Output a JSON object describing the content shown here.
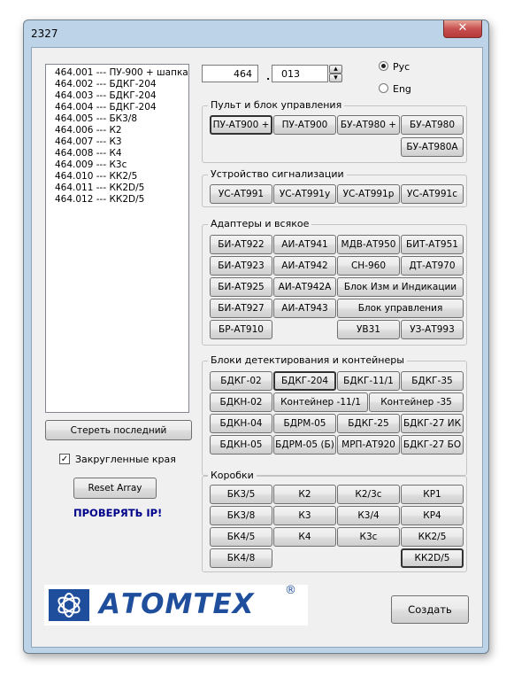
{
  "window": {
    "title": "2327",
    "close_glyph": "✕"
  },
  "list": {
    "items": [
      "464.001 --- ПУ-900 + шапка",
      "464.002 --- БДКГ-204",
      "464.003 --- БДКГ-204",
      "464.004 --- БДКГ-204",
      "464.005 --- БК3/8",
      "464.006 --- К2",
      "464.007 --- К3",
      "464.008 --- К4",
      "464.009 --- К3с",
      "464.010 --- КК2/5",
      "464.011 --- КК2D/5",
      "464.012 --- КК2D/5"
    ]
  },
  "left": {
    "clear_label": "Стереть последний",
    "rounded_label": "Закругленные края",
    "rounded_checked": "✓",
    "reset_label": "Reset Array",
    "warning": "ПРОВЕРЯТЬ IP!",
    "warning_color": "#00008b"
  },
  "top": {
    "field1": "464",
    "dot": ".",
    "field2": "013",
    "spin_up": "▴",
    "spin_down": "▾",
    "lang_rus": "Рус",
    "lang_eng": "Eng"
  },
  "groups": {
    "remote": {
      "label": "Пульт и блок управления",
      "buttons": [
        "ПУ-АТ900 +",
        "ПУ-АТ900",
        "БУ-АТ980 +",
        "БУ-АТ980",
        "БУ-АТ980А"
      ]
    },
    "signal": {
      "label": "Устройство сигнализации",
      "buttons": [
        "УС-АТ991",
        "УС-АТ991у",
        "УС-АТ991р",
        "УС-АТ991с"
      ]
    },
    "adapters": {
      "label": "Адаптеры и всякое",
      "buttons": [
        "БИ-АТ922",
        "АИ-АТ941",
        "МДВ-АТ950",
        "БИТ-АТ951",
        "БИ-АТ923",
        "АИ-АТ942",
        "СН-960",
        "ДТ-АТ970",
        "БИ-АТ925",
        "АИ-АТ942А",
        "Блок Изм и Индикации",
        "БИ-АТ927",
        "АИ-АТ943",
        "Блок управления",
        "БР-АТ910",
        "УВ31",
        "УЗ-АТ993"
      ]
    },
    "detectors": {
      "label": "Блоки детектирования и контейнеры",
      "buttons": [
        "БДКГ-02",
        "БДКГ-204",
        "БДКГ-11/1",
        "БДКГ-35",
        "БДКН-02",
        "Контейнер -11/1",
        "Контейнер -35",
        "БДКН-04",
        "БДРМ-05",
        "БДКГ-25",
        "БДКГ-27 ИК",
        "БДКН-05",
        "БДРМ-05 (Б)",
        "МРП-АТ920",
        "БДКГ-27 БО"
      ]
    },
    "boxes": {
      "label": "Коробки",
      "buttons": [
        "БК3/5",
        "К2",
        "К2/3с",
        "КР1",
        "БК3/8",
        "К3",
        "К3/4",
        "КР4",
        "БК4/5",
        "К4",
        "К3с",
        "КК2/5",
        "БК4/8",
        "КК2D/5"
      ]
    }
  },
  "logo": {
    "text": "АТОМТЕХ",
    "registered": "®",
    "color": "#1f4e9c"
  },
  "create_label": "Создать"
}
